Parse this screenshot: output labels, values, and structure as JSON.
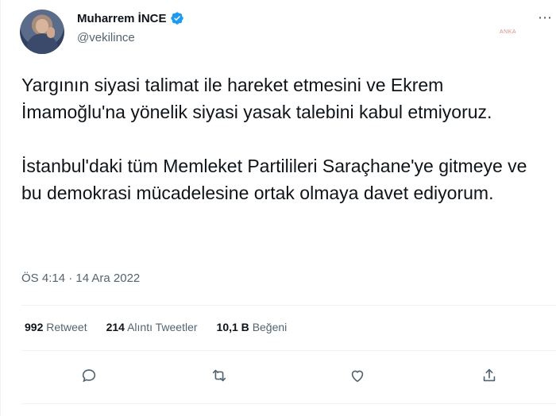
{
  "author": {
    "display_name": "Muharrem İNCE",
    "handle": "@vekilince",
    "verified": true,
    "avatar": "profile-photo"
  },
  "watermark_text": "ANKA",
  "tweet": {
    "text": "Yargının siyasi talimat ile hareket etmesini ve Ekrem İmamoğlu'na yönelik siyasi yasak talebini kabul etmiyoruz.\n\nİstanbul'daki tüm Memleket Partilileri Saraçhane'ye gitmeye ve bu demokrasi mücadelesine ortak olmaya davet ediyorum.",
    "timestamp": "ÖS 4:14 · 14 Ara 2022"
  },
  "stats": {
    "retweets_value": "992",
    "retweets_label": "Retweet",
    "quotes_value": "214",
    "quotes_label": "Alıntı Tweetler",
    "likes_value": "10,1 B",
    "likes_label": "Beğeni"
  },
  "actions": [
    "reply-icon",
    "retweet-icon",
    "like-icon",
    "share-icon"
  ],
  "colors": {
    "text": "#0f1419",
    "secondary": "#536471",
    "verified": "#1d9bf0",
    "divider": "#eff3f4"
  }
}
